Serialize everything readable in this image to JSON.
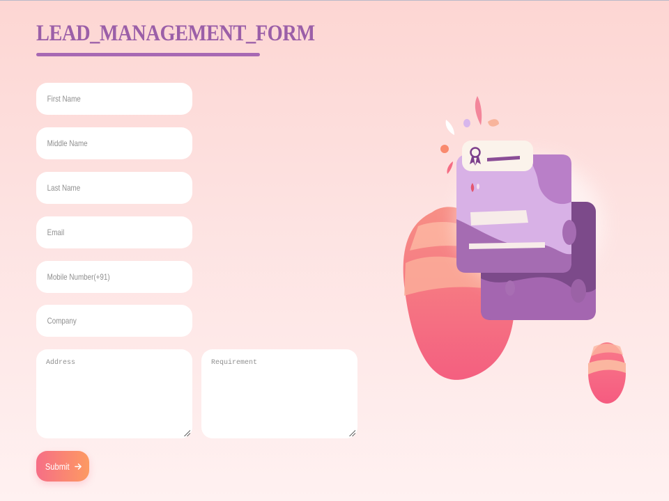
{
  "form": {
    "title": "LEAD_MANAGEMENT_FORM",
    "fields": {
      "first_name": {
        "placeholder": "First Name",
        "value": ""
      },
      "middle_name": {
        "placeholder": "Middle Name",
        "value": ""
      },
      "last_name": {
        "placeholder": "Last Name",
        "value": ""
      },
      "email": {
        "placeholder": "Email",
        "value": ""
      },
      "mobile": {
        "placeholder": "Mobile Number(+91)",
        "value": ""
      },
      "company": {
        "placeholder": "Company",
        "value": ""
      },
      "address": {
        "placeholder": "Address",
        "value": ""
      },
      "requirement": {
        "placeholder": "Requirement",
        "value": ""
      }
    },
    "submit_label": "Submit",
    "submit_icon": "arrow-right-icon"
  },
  "colors": {
    "title": "#9b5fa8",
    "submit_gradient_start": "#f66e86",
    "submit_gradient_end": "#fd9a62",
    "background_top": "#fdd6d3",
    "background_bottom": "#fff1f1"
  },
  "illustration": {
    "icon": "certificate-cards-illustration"
  }
}
